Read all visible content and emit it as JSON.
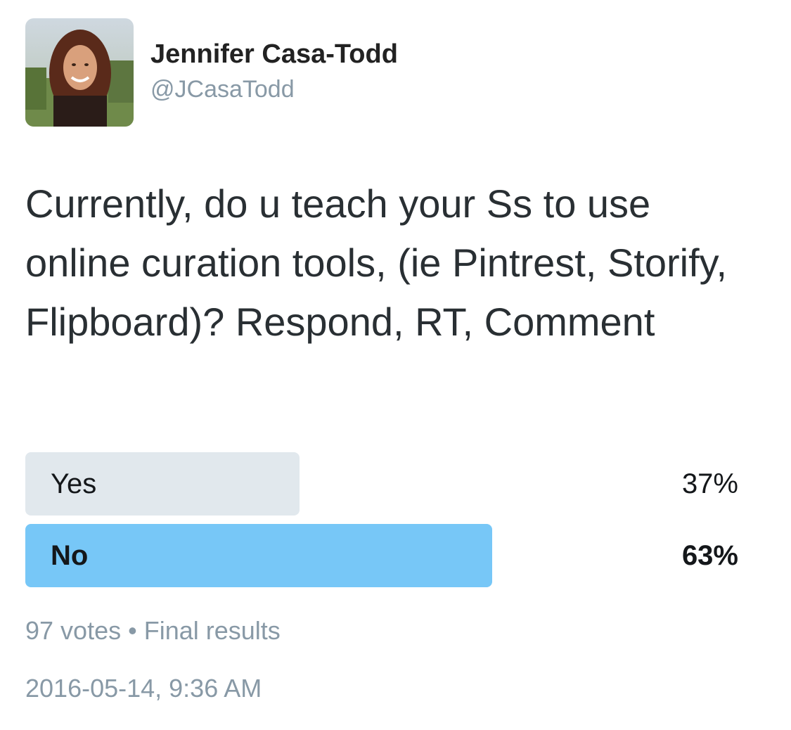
{
  "author": {
    "name": "Jennifer Casa-Todd",
    "handle": "@JCasaTodd"
  },
  "tweet": {
    "text": "Currently, do u teach your Ss to use online curation tools, (ie Pintrest, Storify, Flipboard)? Respond, RT, Comment"
  },
  "poll": {
    "options": [
      {
        "label": "Yes",
        "percent_label": "37%",
        "percent": 37,
        "winner": false
      },
      {
        "label": "No",
        "percent_label": "63%",
        "percent": 63,
        "winner": true
      }
    ],
    "votes": "97 votes",
    "separator": "•",
    "status": "Final results"
  },
  "timestamp": "2016-05-14, 9:36 AM",
  "colors": {
    "bar_default": "#e1e8ed",
    "bar_winner": "#77c7f7",
    "secondary_text": "#8899a6"
  },
  "icons": {
    "avatar": "profile-photo"
  }
}
